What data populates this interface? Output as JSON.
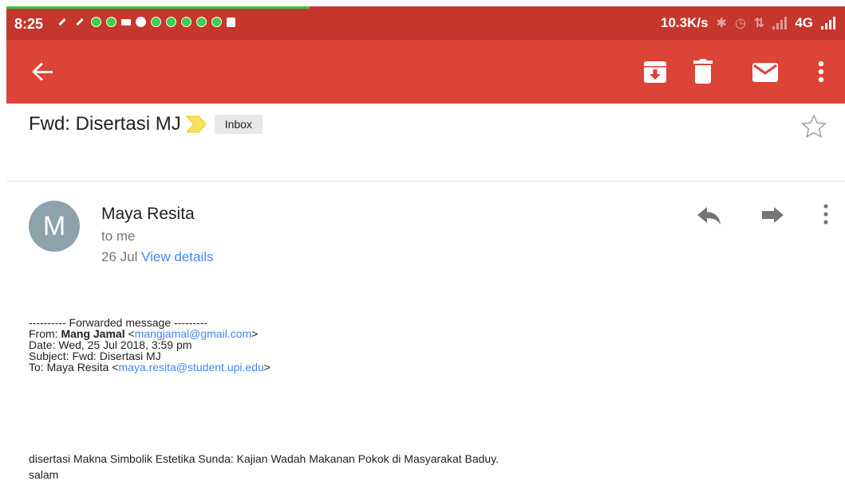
{
  "status_bar": {
    "time": "8:25",
    "net_speed": "10.3K/s",
    "network": "4G"
  },
  "app_bar": {
    "icons": [
      "back-arrow-icon",
      "archive-icon",
      "delete-icon",
      "mark-unread-icon",
      "more-vert-icon"
    ]
  },
  "email": {
    "subject": "Fwd: Disertasi MJ",
    "label": "Inbox",
    "sender": {
      "initial": "M",
      "name": "Maya Resita",
      "recipient": "to me",
      "date": "26 Jul",
      "view_details": "View details"
    },
    "forwarded": {
      "header": "---------- Forwarded message ---------",
      "from_label": "From: ",
      "from_name": "Mang Jamal",
      "from_email": "mangjamal@gmail.com",
      "date_line": "Date: Wed, 25 Jul 2018, 3:59 pm",
      "subject_line": "Subject: Fwd: Disertasi MJ",
      "to_label": "To: Maya Resita ",
      "to_email": "maya.resita@student.upi.edu"
    },
    "body": [
      "disertasi Makna Simbolik Estetika Sunda: Kajian Wadah Makanan Pokok di Masyarakat Baduy.",
      "salam"
    ]
  },
  "colors": {
    "status_bar": "#c5362c",
    "app_bar": "#db4437",
    "link": "#4285f4",
    "avatar": "#8ea2ac"
  }
}
